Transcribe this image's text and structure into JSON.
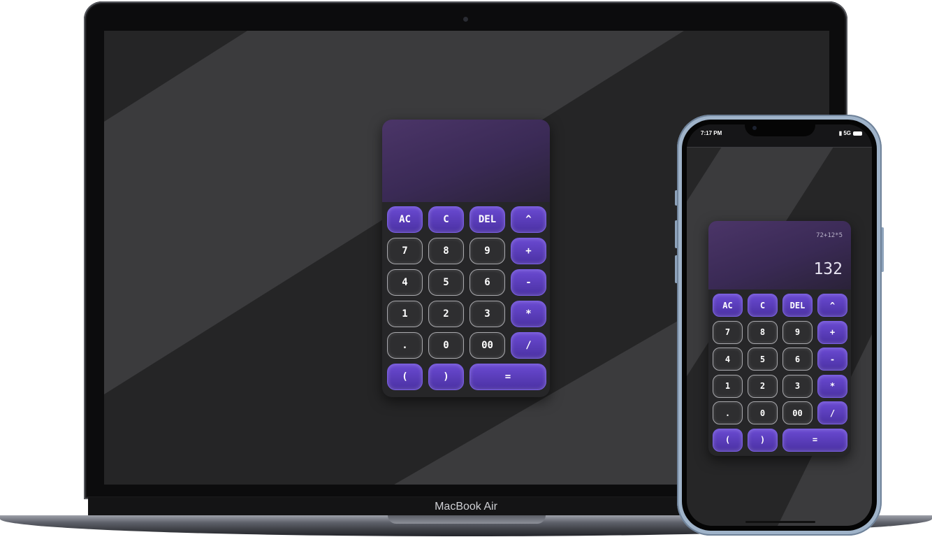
{
  "laptop": {
    "label": "MacBook Air"
  },
  "phone": {
    "status": {
      "time": "7:17 PM",
      "signal": "5G"
    }
  },
  "calculator_desktop": {
    "expression": "",
    "result": ""
  },
  "calculator_mobile": {
    "expression": "72+12*5",
    "result": "132"
  },
  "keys": [
    {
      "label": "AC",
      "type": "op",
      "name": "clear-all-button"
    },
    {
      "label": "C",
      "type": "op",
      "name": "clear-button"
    },
    {
      "label": "DEL",
      "type": "op",
      "name": "delete-button"
    },
    {
      "label": "^",
      "type": "op",
      "name": "power-button"
    },
    {
      "label": "7",
      "type": "num",
      "name": "digit-7-button"
    },
    {
      "label": "8",
      "type": "num",
      "name": "digit-8-button"
    },
    {
      "label": "9",
      "type": "num",
      "name": "digit-9-button"
    },
    {
      "label": "+",
      "type": "op",
      "name": "plus-button"
    },
    {
      "label": "4",
      "type": "num",
      "name": "digit-4-button"
    },
    {
      "label": "5",
      "type": "num",
      "name": "digit-5-button"
    },
    {
      "label": "6",
      "type": "num",
      "name": "digit-6-button"
    },
    {
      "label": "-",
      "type": "op",
      "name": "minus-button"
    },
    {
      "label": "1",
      "type": "num",
      "name": "digit-1-button"
    },
    {
      "label": "2",
      "type": "num",
      "name": "digit-2-button"
    },
    {
      "label": "3",
      "type": "num",
      "name": "digit-3-button"
    },
    {
      "label": "*",
      "type": "op",
      "name": "multiply-button"
    },
    {
      "label": ".",
      "type": "num",
      "name": "decimal-button"
    },
    {
      "label": "0",
      "type": "num",
      "name": "digit-0-button"
    },
    {
      "label": "00",
      "type": "num",
      "name": "double-zero-button"
    },
    {
      "label": "/",
      "type": "op",
      "name": "divide-button"
    },
    {
      "label": "(",
      "type": "op",
      "name": "open-paren-button"
    },
    {
      "label": ")",
      "type": "op",
      "name": "close-paren-button"
    },
    {
      "label": "=",
      "type": "op",
      "name": "equals-button",
      "wide": true
    }
  ],
  "colors": {
    "accent": "#5b3ec2",
    "display_top": "#4b3568",
    "calc_body": "#262628",
    "wallpaper_dark": "#252526",
    "wallpaper_light": "#3c3c3e"
  }
}
